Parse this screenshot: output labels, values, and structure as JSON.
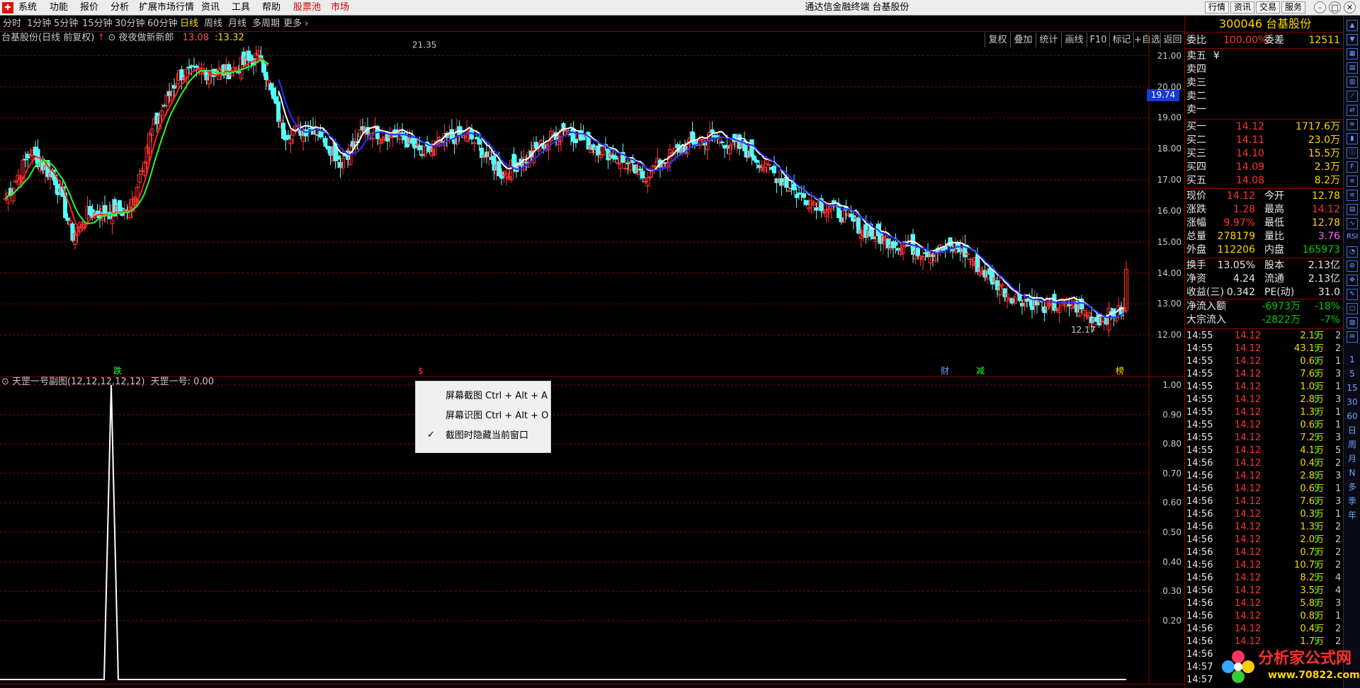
{
  "menubar": {
    "logo": "",
    "items": [
      "系统",
      "功能",
      "报价",
      "分析",
      "扩展市场行情",
      "资讯",
      "工具",
      "帮助",
      "股票池",
      "市场"
    ],
    "title": "通达信金融终端 台基股份",
    "right_buttons": [
      "行情",
      "资讯",
      "交易",
      "服务"
    ]
  },
  "periodbar": {
    "items": [
      "分时",
      "1分钟",
      "5分钟",
      "15分钟",
      "30分钟",
      "60分钟",
      "日线",
      "周线",
      "月线",
      "多周期",
      "更多"
    ],
    "active": "日线",
    "right_items": [
      "复权",
      "叠加",
      "统计",
      "画线",
      "F10",
      "标记",
      "+自选",
      "返回"
    ]
  },
  "chart": {
    "title_name": "台基股份(日线 前复权)",
    "indicator_name": "夜夜做新新郎",
    "val1": "13.08",
    "val2": ":13.32",
    "high_label": "21.35",
    "low_label": "12.17",
    "current_price": "19.74",
    "markers": [
      "跌",
      "$",
      "财",
      "减",
      "榜"
    ]
  },
  "chart_data": {
    "type": "candlestick",
    "y_ticks_main": [
      "21.00",
      "20.00",
      "19.00",
      "18.00",
      "17.00",
      "16.00",
      "15.00",
      "14.00",
      "13.00",
      "12.00"
    ],
    "ylim_main": [
      11.8,
      21.7
    ],
    "high": 21.35,
    "low": 12.17,
    "last_close": 14.12,
    "waypoints": [
      [
        0,
        16.4
      ],
      [
        10,
        17.9
      ],
      [
        20,
        17.0
      ],
      [
        27,
        15.2
      ],
      [
        33,
        15.9
      ],
      [
        50,
        16.0
      ],
      [
        58,
        18.4
      ],
      [
        70,
        20.4
      ],
      [
        90,
        20.5
      ],
      [
        103,
        21.0
      ],
      [
        107,
        19.8
      ],
      [
        112,
        18.5
      ],
      [
        125,
        18.7
      ],
      [
        135,
        17.6
      ],
      [
        145,
        18.6
      ],
      [
        160,
        18.4
      ],
      [
        168,
        17.8
      ],
      [
        178,
        18.3
      ],
      [
        186,
        18.5
      ],
      [
        200,
        17.2
      ],
      [
        210,
        17.7
      ],
      [
        225,
        18.7
      ],
      [
        232,
        18.3
      ],
      [
        245,
        17.8
      ],
      [
        257,
        17.1
      ],
      [
        272,
        18.0
      ],
      [
        285,
        18.4
      ],
      [
        300,
        17.9
      ],
      [
        320,
        16.5
      ],
      [
        335,
        16.0
      ],
      [
        350,
        15.2
      ],
      [
        370,
        14.7
      ],
      [
        385,
        14.8
      ],
      [
        395,
        14.0
      ],
      [
        405,
        13.3
      ],
      [
        420,
        12.9
      ],
      [
        430,
        13.0
      ],
      [
        440,
        12.5
      ],
      [
        452,
        12.8
      ]
    ],
    "y_ticks_sub": [
      "1.00",
      "0.90",
      "0.80",
      "0.70",
      "0.60",
      "0.50",
      "0.40",
      "0.30",
      "0.20"
    ],
    "ylim_sub": [
      0,
      1
    ],
    "sub_series": {
      "name": "天罡一号",
      "spike_bar": 44,
      "spike_value": 1.0
    }
  },
  "subchart": {
    "title": "天罡一号副图(12,12,12,12,12)",
    "value_label": "天罡一号: 0.00"
  },
  "context_menu": {
    "items": [
      "屏幕截图 Ctrl + Alt + A",
      "屏幕识图 Ctrl + Alt + O",
      "截图时隐藏当前窗口"
    ]
  },
  "panel": {
    "code": "300046",
    "name": "台基股份",
    "weibi_label": "委比",
    "weibi_value": "100.00%",
    "weicha_label": "委差",
    "weicha_value": "12511",
    "sell": [
      {
        "label": "卖五",
        "price": "¥"
      },
      {
        "label": "卖四",
        "price": ""
      },
      {
        "label": "卖三",
        "price": ""
      },
      {
        "label": "卖二",
        "price": ""
      },
      {
        "label": "卖一",
        "price": ""
      }
    ],
    "buy": [
      {
        "label": "买一",
        "price": "14.12",
        "vol": "1717.6万"
      },
      {
        "label": "买二",
        "price": "14.11",
        "vol": "23.0万"
      },
      {
        "label": "买三",
        "price": "14.10",
        "vol": "15.5万"
      },
      {
        "label": "买四",
        "price": "14.09",
        "vol": "2.3万"
      },
      {
        "label": "买五",
        "price": "14.08",
        "vol": "8.2万"
      }
    ],
    "quote": [
      {
        "l1": "现价",
        "v1": "14.12",
        "l2": "今开",
        "v2": "12.78"
      },
      {
        "l1": "涨跌",
        "v1": "1.28",
        "l2": "最高",
        "v2": "14.12"
      },
      {
        "l1": "涨幅",
        "v1": "9.97%",
        "l2": "最低",
        "v2": "12.78"
      },
      {
        "l1": "总量",
        "v1": "278179",
        "l2": "量比",
        "v2": "3.76"
      },
      {
        "l1": "外盘",
        "v1": "112206",
        "l2": "内盘",
        "v2": "165973"
      }
    ],
    "fund": [
      {
        "l1": "换手",
        "v1": "13.05%",
        "l2": "股本",
        "v2": "2.13亿"
      },
      {
        "l1": "净资",
        "v1": "4.24",
        "l2": "流通",
        "v2": "2.13亿"
      },
      {
        "l1": "收益(三)",
        "v1": "0.342",
        "l2": "PE(动)",
        "v2": "31.0"
      }
    ],
    "flow": [
      {
        "label": "净流入额",
        "value": "-6973万",
        "pct": "-18%"
      },
      {
        "label": "大宗流入",
        "value": "-2822万",
        "pct": "-7%"
      }
    ],
    "ticks": [
      {
        "t": "14:55",
        "p": "14.12",
        "v": "2.1万",
        "s": "S",
        "n": "2"
      },
      {
        "t": "14:55",
        "p": "14.12",
        "v": "43.1万",
        "s": "S",
        "n": "2"
      },
      {
        "t": "14:55",
        "p": "14.12",
        "v": "0.6万",
        "s": "S",
        "n": "1"
      },
      {
        "t": "14:55",
        "p": "14.12",
        "v": "7.6万",
        "s": "S",
        "n": "3"
      },
      {
        "t": "14:55",
        "p": "14.12",
        "v": "1.0万",
        "s": "S",
        "n": "1"
      },
      {
        "t": "14:55",
        "p": "14.12",
        "v": "2.8万",
        "s": "S",
        "n": "3"
      },
      {
        "t": "14:55",
        "p": "14.12",
        "v": "1.3万",
        "s": "S",
        "n": "1"
      },
      {
        "t": "14:55",
        "p": "14.12",
        "v": "0.6万",
        "s": "S",
        "n": "1"
      },
      {
        "t": "14:55",
        "p": "14.12",
        "v": "7.2万",
        "s": "S",
        "n": "3"
      },
      {
        "t": "14:55",
        "p": "14.12",
        "v": "4.1万",
        "s": "S",
        "n": "5"
      },
      {
        "t": "14:56",
        "p": "14.12",
        "v": "0.4万",
        "s": "S",
        "n": "2"
      },
      {
        "t": "14:56",
        "p": "14.12",
        "v": "2.8万",
        "s": "S",
        "n": "3"
      },
      {
        "t": "14:56",
        "p": "14.12",
        "v": "0.6万",
        "s": "S",
        "n": "1"
      },
      {
        "t": "14:56",
        "p": "14.12",
        "v": "7.6万",
        "s": "S",
        "n": "3"
      },
      {
        "t": "14:56",
        "p": "14.12",
        "v": "0.3万",
        "s": "S",
        "n": "1"
      },
      {
        "t": "14:56",
        "p": "14.12",
        "v": "1.3万",
        "s": "S",
        "n": "2"
      },
      {
        "t": "14:56",
        "p": "14.12",
        "v": "2.0万",
        "s": "S",
        "n": "2"
      },
      {
        "t": "14:56",
        "p": "14.12",
        "v": "0.7万",
        "s": "S",
        "n": "2"
      },
      {
        "t": "14:56",
        "p": "14.12",
        "v": "10.7万",
        "s": "S",
        "n": "2"
      },
      {
        "t": "14:56",
        "p": "14.12",
        "v": "8.2万",
        "s": "S",
        "n": "4"
      },
      {
        "t": "14:56",
        "p": "14.12",
        "v": "3.5万",
        "s": "S",
        "n": "4"
      },
      {
        "t": "14:56",
        "p": "14.12",
        "v": "5.8万",
        "s": "S",
        "n": "3"
      },
      {
        "t": "14:56",
        "p": "14.12",
        "v": "0.8万",
        "s": "S",
        "n": "1"
      },
      {
        "t": "14:56",
        "p": "14.12",
        "v": "0.4万",
        "s": "S",
        "n": "2"
      },
      {
        "t": "14:56",
        "p": "14.12",
        "v": "1.7万",
        "s": "S",
        "n": "2"
      },
      {
        "t": "14:56",
        "p": "",
        "v": "",
        "s": "",
        "n": ""
      },
      {
        "t": "14:57",
        "p": "",
        "v": "",
        "s": "",
        "n": ""
      },
      {
        "t": "14:57",
        "p": "",
        "v": "",
        "s": "",
        "n": ""
      }
    ]
  },
  "sidebar": {
    "icons": [
      "arrow-up-icon",
      "arrow-down-icon",
      "grid-icon",
      "bars-icon",
      "table-icon",
      "line-chart-icon",
      "compare-icon",
      "flow-icon",
      "candle-icon",
      "info-icon",
      "f10-icon",
      "list-icon",
      "list-icon",
      "news-icon",
      "wave-icon",
      "rsi-icon",
      "pie-icon",
      "gear-icon",
      "move-icon",
      "pen-icon",
      "box-icon",
      "stats-icon",
      "chat-icon"
    ],
    "rsi_label": "RSI",
    "periods": [
      "1",
      "5",
      "15",
      "30",
      "60",
      "日",
      "周",
      "月",
      "N",
      "多",
      "季",
      "年"
    ]
  },
  "watermark": {
    "text": "分析家公式网",
    "url": "www.70822.com"
  },
  "colors": {
    "up": "#ff3333",
    "down": "#54ffff",
    "ma_white": "#ffffff",
    "ma_blue": "#2233ff",
    "ma_red": "#ff2020",
    "ma_green": "#22ff22",
    "grid": "#8b0000",
    "accent": "#ffd700"
  }
}
